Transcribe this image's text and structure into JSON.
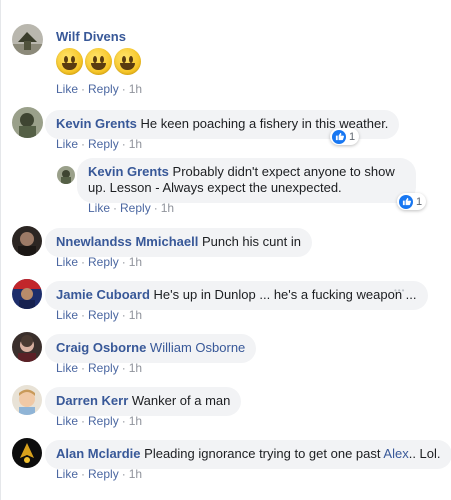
{
  "comments": [
    {
      "name": "Wilf Divens",
      "text": "",
      "actions": {
        "like": "Like",
        "reply": "Reply",
        "time": "1h"
      },
      "emojis": [
        "grinning-face-emoji",
        "grinning-face-emoji",
        "grinning-face-emoji"
      ]
    },
    {
      "name": "Kevin Grents",
      "text": "He keen poaching a fishery in this weather.",
      "actions": {
        "like": "Like",
        "reply": "Reply",
        "time": "1h"
      },
      "reactions": "1"
    },
    {
      "name": "Kevin Grents",
      "text": "Probably didn't expect anyone to show up. Lesson - Always expect the unexpected.",
      "actions": {
        "like": "Like",
        "reply": "Reply",
        "time": "1h"
      },
      "reactions": "1"
    },
    {
      "name": "Nnewlandss Mmichaell",
      "text": "Punch his cunt in",
      "actions": {
        "like": "Like",
        "reply": "Reply",
        "time": "1h"
      }
    },
    {
      "name": "Jamie Cuboard",
      "text": "He's up in Dunlop ... he's a fucking weapon ...",
      "actions": {
        "like": "Like",
        "reply": "Reply",
        "time": "1h"
      },
      "more": "•••"
    },
    {
      "name": "Craig Osborne",
      "mention": "William Osborne",
      "actions": {
        "like": "Like",
        "reply": "Reply",
        "time": "1h"
      }
    },
    {
      "name": "Darren Kerr",
      "text": "Wanker of a man",
      "actions": {
        "like": "Like",
        "reply": "Reply",
        "time": "1h"
      }
    },
    {
      "name": "Alan Mclardie",
      "text": "Pleading ignorance trying to get one past",
      "mention": "Alex",
      "text_after": ".. Lol.",
      "actions": {
        "like": "Like",
        "reply": "Reply",
        "time": "1h"
      }
    }
  ],
  "colors": {
    "link": "#385898",
    "bubble": "#f2f3f5",
    "meta": "#90949c",
    "like_blue": "#1877f2"
  }
}
